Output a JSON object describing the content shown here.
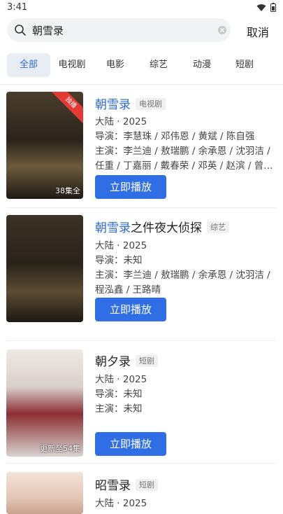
{
  "status": {
    "time": "3:41"
  },
  "search": {
    "query": "朝雪录",
    "cancel_label": "取消"
  },
  "tabs": [
    {
      "label": "全部",
      "active": true
    },
    {
      "label": "电视剧"
    },
    {
      "label": "电影"
    },
    {
      "label": "综艺"
    },
    {
      "label": "动漫"
    },
    {
      "label": "短剧"
    }
  ],
  "results": [
    {
      "title_highlight": "朝雪录",
      "title_rest": "",
      "tag": "电视剧",
      "region_year": "大陆 · 2025",
      "director": "导演：李慧珠 / 邓伟恩 / 黄斌 / 陈自强",
      "cast": [
        "主演：李兰迪 / 敖瑞鹏 / 余承恩 / 沈羽洁 /",
        "任重 / 丁嘉丽 / 戴春荣 / 邓英 / 赵滨 / 曾泳..."
      ],
      "poster_caption": "38集全",
      "poster_badge": "独播",
      "play_label": "立即播放"
    },
    {
      "title_highlight": "朝雪录",
      "title_rest": "之件夜大侦探",
      "tag": "综艺",
      "region_year": "大陆 · 2025",
      "director": "导演：未知",
      "cast": [
        "主演：李兰迪 / 敖瑞鹏 / 余承恩 / 沈羽洁 /",
        "程泓鑫 / 王路晴"
      ],
      "poster_caption": "",
      "poster_badge": "",
      "play_label": "立即播放"
    },
    {
      "title_highlight": "",
      "title_rest": "朝夕录",
      "tag": "短剧",
      "region_year": "大陆 · 2025",
      "director": "导演：未知",
      "cast": [
        "主演：未知"
      ],
      "poster_caption": "更新至54集",
      "poster_badge": "",
      "play_label": "立即播放"
    },
    {
      "title_highlight": "",
      "title_rest": "昭雪录",
      "tag": "短剧",
      "region_year": "大陆 · 2025",
      "director": "",
      "cast": [],
      "poster_caption": "",
      "poster_badge": "",
      "play_label": ""
    }
  ],
  "colors": {
    "accent": "#2f6ee5",
    "highlight": "#2d6ad8",
    "badge": "#e53935"
  }
}
